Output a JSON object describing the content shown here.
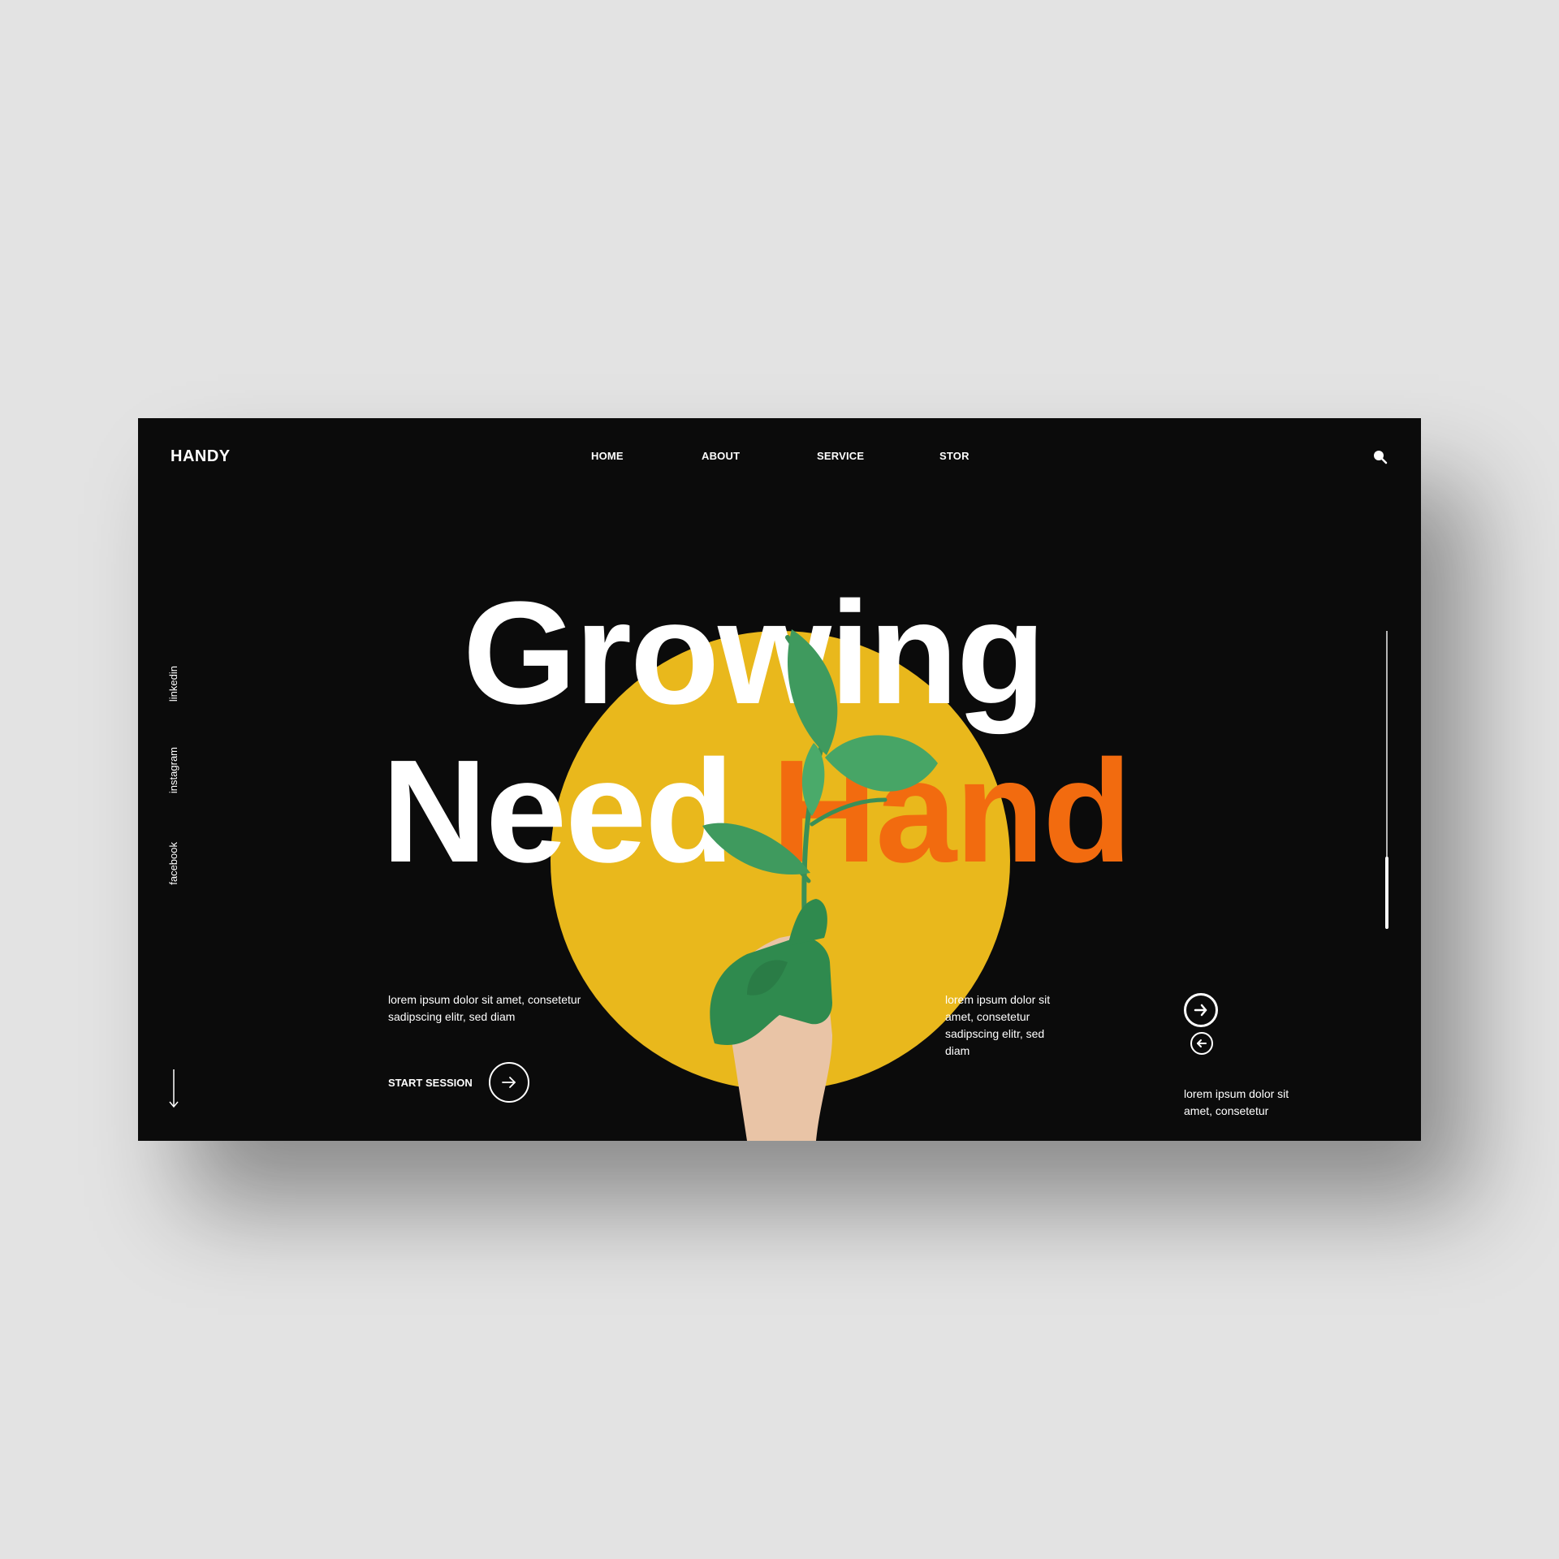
{
  "brand": {
    "logo": "HANDY"
  },
  "nav": {
    "items": [
      {
        "label": "HOME"
      },
      {
        "label": "ABOUT"
      },
      {
        "label": "SERVICE"
      },
      {
        "label": "STOR"
      }
    ],
    "search_icon": "search-icon"
  },
  "social": {
    "items": [
      {
        "label": "linkedin"
      },
      {
        "label": "instagram"
      },
      {
        "label": "facebook"
      }
    ]
  },
  "hero": {
    "line1": "Growing",
    "line2_white": "Need ",
    "line2_accent": "Hand",
    "image": "hand-holding-plant"
  },
  "blocks": {
    "left_text": "lorem ipsum dolor sit amet, consetetur sadipscing elitr, sed diam",
    "cta_label": "START SESSION",
    "mid_text": "lorem ipsum dolor sit amet, consetetur sadipscing elitr, sed diam",
    "right_text": "lorem ipsum dolor sit amet, consetetur"
  },
  "colors": {
    "background": "#0b0b0b",
    "page": "#e3e3e3",
    "circle": "#e9b81c",
    "accent": "#f26b0f",
    "leaf": "#3f9a5e",
    "paint": "#2f8a4e",
    "skin": "#e9c4a6"
  }
}
